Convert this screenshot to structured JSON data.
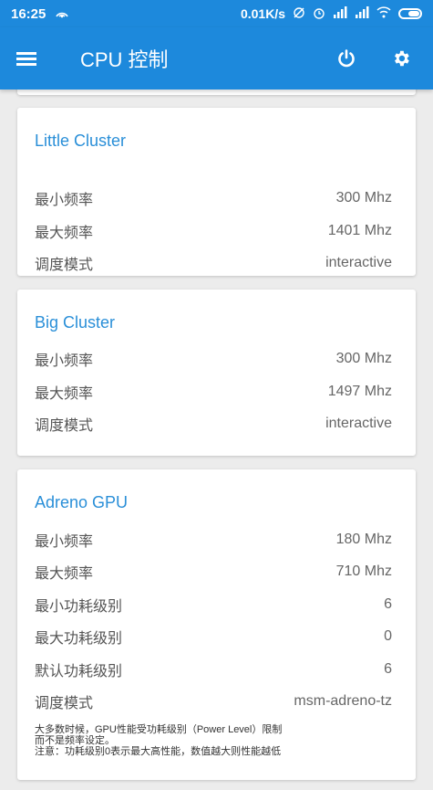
{
  "status_bar": {
    "time": "16:25",
    "net_speed": "0.01K/s"
  },
  "app_bar": {
    "title": "CPU 控制"
  },
  "little_cluster": {
    "title": "Little Cluster",
    "rows": [
      {
        "label": "最小频率",
        "value": "300 Mhz"
      },
      {
        "label": "最大频率",
        "value": "1401 Mhz"
      },
      {
        "label": "调度模式",
        "value": "interactive"
      }
    ]
  },
  "big_cluster": {
    "title": "Big Cluster",
    "rows": [
      {
        "label": "最小频率",
        "value": "300 Mhz"
      },
      {
        "label": "最大频率",
        "value": "1497 Mhz"
      },
      {
        "label": "调度模式",
        "value": "interactive"
      }
    ]
  },
  "gpu": {
    "title": "Adreno GPU",
    "rows": [
      {
        "label": "最小频率",
        "value": "180 Mhz"
      },
      {
        "label": "最大频率",
        "value": "710 Mhz"
      },
      {
        "label": "最小功耗级别",
        "value": "6"
      },
      {
        "label": "最大功耗级别",
        "value": "0"
      },
      {
        "label": "默认功耗级别",
        "value": "6"
      },
      {
        "label": "调度模式",
        "value": "msm-adreno-tz"
      }
    ],
    "note_lines": [
      "大多数时候，GPU性能受功耗级别（Power Level）限制",
      "而不是频率设定。",
      "注意：功耗级别0表示最大高性能，数值越大则性能越低"
    ]
  },
  "colors": {
    "primary": "#1d89dc",
    "accent_title": "#2a8fd8",
    "background": "#ececec"
  }
}
